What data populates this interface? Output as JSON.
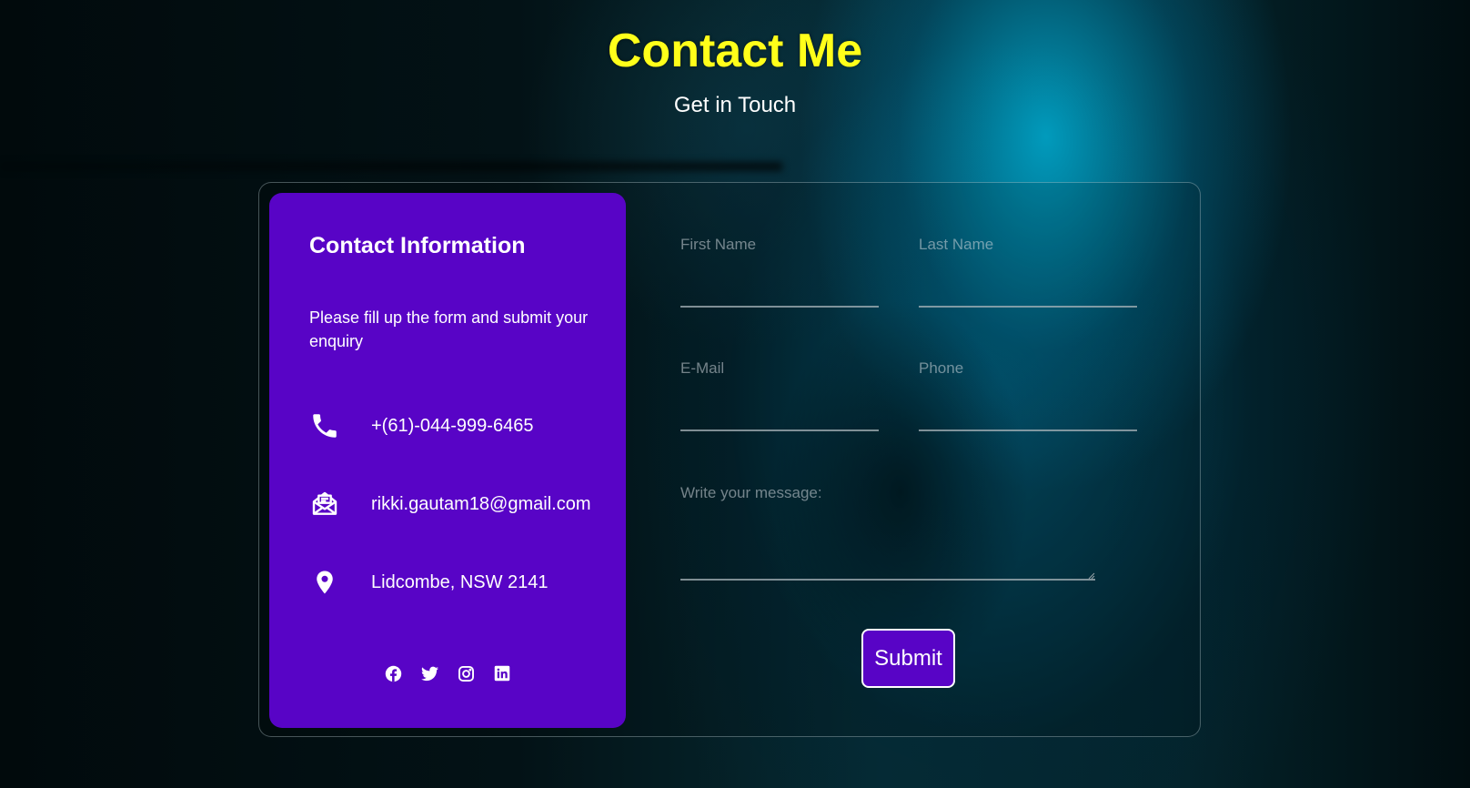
{
  "header": {
    "title": "Contact Me",
    "subtitle": "Get in Touch"
  },
  "info": {
    "title": "Contact Information",
    "description": "Please fill up the form and submit your enquiry",
    "phone": {
      "icon": "phone-icon",
      "text": "+(61)-044-999-6465"
    },
    "email": {
      "icon": "mail-open-icon",
      "text": "rikki.gautam18@gmail.com"
    },
    "location": {
      "icon": "map-pin-icon",
      "text": "Lidcombe, NSW 2141"
    },
    "socials": [
      {
        "icon": "facebook-icon"
      },
      {
        "icon": "twitter-icon"
      },
      {
        "icon": "instagram-icon"
      },
      {
        "icon": "linkedin-icon"
      }
    ]
  },
  "form": {
    "first_name_label": "First Name",
    "last_name_label": "Last Name",
    "email_label": "E-Mail",
    "phone_label": "Phone",
    "message_label": "Write your message:",
    "submit_label": "Submit"
  },
  "colors": {
    "title": "#ffff1a",
    "card": "#5804c6",
    "text": "#ffffff"
  }
}
